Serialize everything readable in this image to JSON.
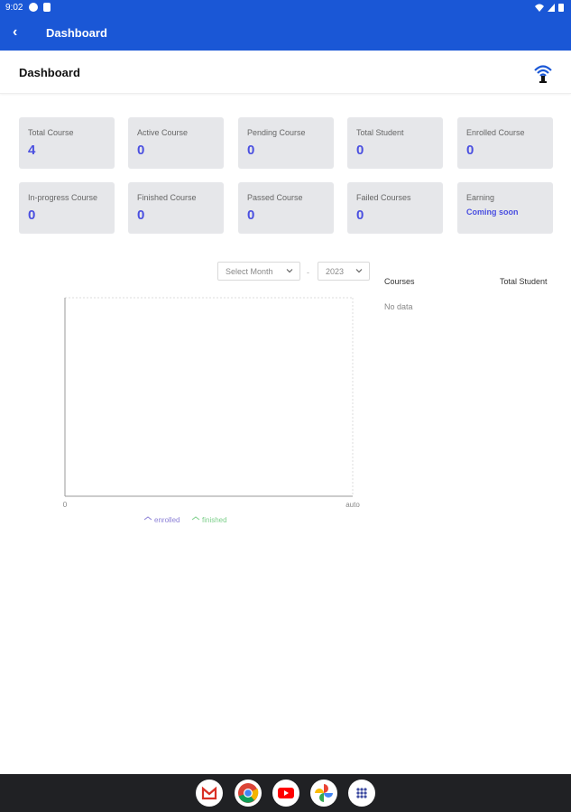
{
  "status_bar": {
    "time": "9:02"
  },
  "app_bar": {
    "back": "‹",
    "title": "Dashboard"
  },
  "header": {
    "title": "Dashboard"
  },
  "stats": [
    {
      "label": "Total Course",
      "value": "4"
    },
    {
      "label": "Active Course",
      "value": "0"
    },
    {
      "label": "Pending Course",
      "value": "0"
    },
    {
      "label": "Total Student",
      "value": "0"
    },
    {
      "label": "Enrolled Course",
      "value": "0"
    },
    {
      "label": "In-progress Course",
      "value": "0"
    },
    {
      "label": "Finished Course",
      "value": "0"
    },
    {
      "label": "Passed Course",
      "value": "0"
    },
    {
      "label": "Failed Courses",
      "value": "0"
    },
    {
      "label": "Earning",
      "value": "Coming soon"
    }
  ],
  "filters": {
    "month_placeholder": "Select Month",
    "separator": "-",
    "year_value": "2023"
  },
  "chart_data": {
    "type": "line",
    "x": [],
    "series": [
      {
        "name": "enrolled",
        "values": []
      },
      {
        "name": "finished",
        "values": []
      }
    ],
    "x_tick_labels": [
      "0",
      "auto"
    ],
    "legend_placement": "bottom",
    "colors": {
      "enrolled": "#8b7fd6",
      "finished": "#7ccf8a"
    }
  },
  "table": {
    "headers": [
      "Courses",
      "Total Student"
    ],
    "empty_text": "No data"
  },
  "dock": {
    "apps": [
      "gmail-icon",
      "chrome-icon",
      "youtube-icon",
      "photos-icon",
      "app-drawer-icon"
    ]
  },
  "theme": {
    "primary": "#1a57d6",
    "accent": "#4a4fe0",
    "card_bg": "#e6e7ea"
  }
}
